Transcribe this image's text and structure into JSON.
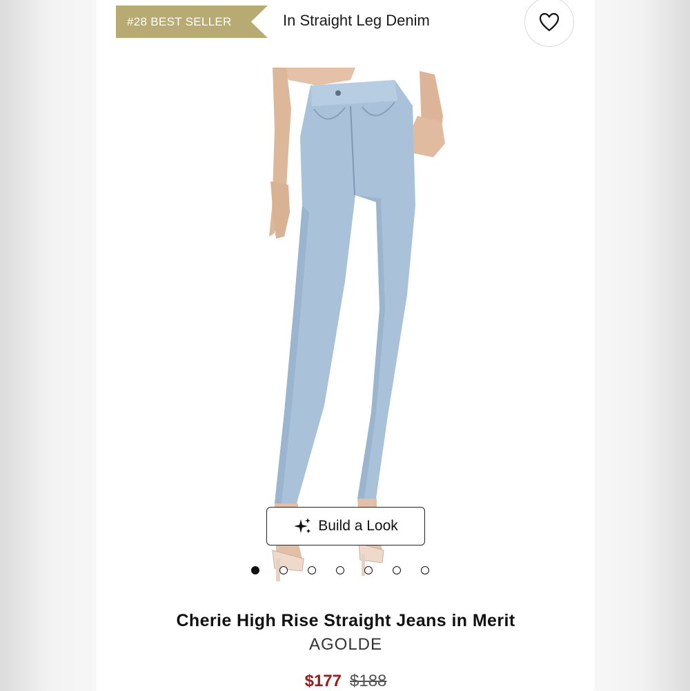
{
  "header": {
    "badge_label": "#28 BEST SELLER",
    "category_label": "In Straight Leg Denim",
    "favorite_icon": "heart-icon"
  },
  "gallery": {
    "build_look_label": "Build a Look",
    "build_look_icon": "sparkles-icon",
    "image_count": 7,
    "active_index": 0
  },
  "product": {
    "name": "Cherie High Rise Straight Jeans in Merit",
    "brand": "AGOLDE",
    "sale_price": "$177",
    "original_price": "$188"
  },
  "colors": {
    "badge": "#b7ab73",
    "sale_price": "#9b1b1b",
    "denim": "#a9c2da"
  }
}
